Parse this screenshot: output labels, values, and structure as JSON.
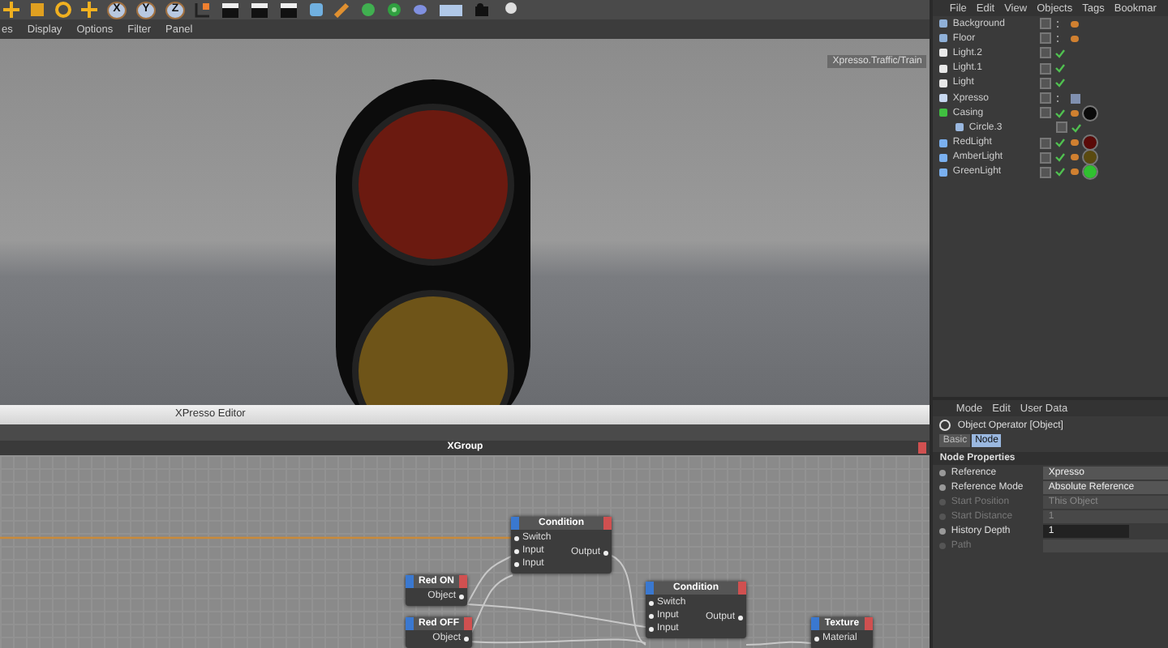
{
  "toolbar": {
    "axis_buttons": [
      "X",
      "Y",
      "Z"
    ]
  },
  "viewport_menu": [
    "es",
    "Display",
    "Options",
    "Filter",
    "Panel"
  ],
  "viewport": {
    "camera_label": "Xpresso.Traffic/Train"
  },
  "xpresso_editor": {
    "title": "XPresso Editor",
    "group": "XGroup",
    "nodes": [
      {
        "title": "Condition",
        "inputs": [
          "Switch",
          "Input",
          "Input"
        ],
        "outputs": [
          "Output"
        ]
      },
      {
        "title": "Red ON",
        "outputs": [
          "Object"
        ]
      },
      {
        "title": "Red OFF",
        "outputs": [
          "Object"
        ]
      },
      {
        "title": "Condition",
        "inputs": [
          "Switch",
          "Input",
          "Input"
        ],
        "outputs": [
          "Output"
        ]
      },
      {
        "title": "Texture",
        "inputs": [
          "Material"
        ]
      }
    ]
  },
  "object_manager": {
    "menu": [
      "File",
      "Edit",
      "View",
      "Objects",
      "Tags",
      "Bookmar"
    ],
    "objects": [
      {
        "name": "Background",
        "kind": "background",
        "check": false,
        "phong_tag": true
      },
      {
        "name": "Floor",
        "kind": "floor",
        "check": false,
        "phong_tag": true
      },
      {
        "name": "Light.2",
        "kind": "light",
        "check": true
      },
      {
        "name": "Light.1",
        "kind": "light",
        "check": true
      },
      {
        "name": "Light",
        "kind": "light",
        "check": true
      },
      {
        "name": "Xpresso",
        "kind": "xpresso",
        "check": false,
        "xpresso_tag": true
      },
      {
        "name": "Casing",
        "kind": "casing",
        "check": true,
        "phong_tag": true,
        "color": "#0a0a0a",
        "children": [
          {
            "name": "Circle.3",
            "kind": "spline",
            "check": true
          }
        ]
      },
      {
        "name": "RedLight",
        "kind": "cylinder",
        "check": true,
        "phong_tag": true,
        "color": "#5a0a08"
      },
      {
        "name": "AmberLight",
        "kind": "cylinder",
        "check": true,
        "phong_tag": true,
        "color": "#5a4a10"
      },
      {
        "name": "GreenLight",
        "kind": "cylinder",
        "check": true,
        "phong_tag": true,
        "color": "#30c030"
      }
    ]
  },
  "attributes": {
    "menu": [
      "Mode",
      "Edit",
      "User Data"
    ],
    "title": "Object Operator [Object]",
    "tabs": [
      {
        "label": "Basic",
        "selected": false
      },
      {
        "label": "Node",
        "selected": true
      }
    ],
    "section": "Node Properties",
    "fields": [
      {
        "label": "Reference",
        "value": "Xpresso",
        "disabled": false
      },
      {
        "label": "Reference Mode",
        "value": "Absolute Reference",
        "disabled": false
      },
      {
        "label": "Start Position",
        "value": "This Object",
        "disabled": true
      },
      {
        "label": "Start Distance",
        "value": "1",
        "disabled": true
      },
      {
        "label": "History Depth",
        "value": "1",
        "disabled": false
      },
      {
        "label": "Path",
        "disabled": true
      }
    ]
  }
}
